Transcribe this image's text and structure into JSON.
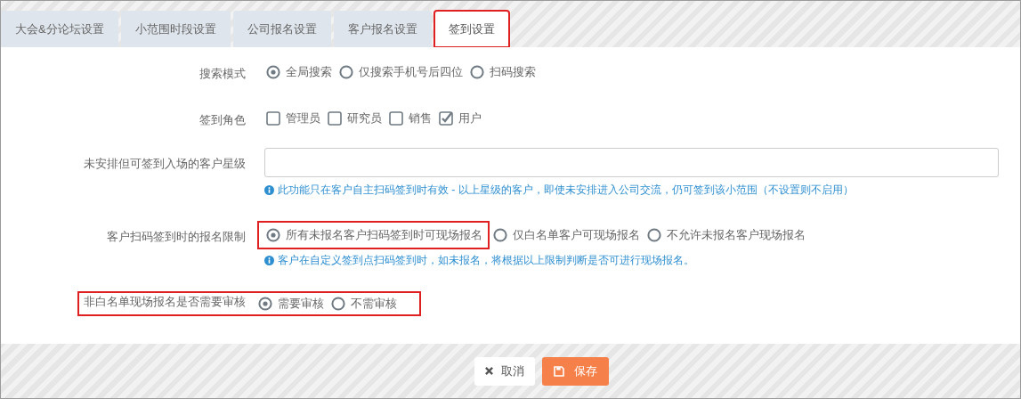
{
  "tabs": [
    {
      "label": "大会&分论坛设置",
      "selected": false,
      "highlighted": false
    },
    {
      "label": "小范围时段设置",
      "selected": false,
      "highlighted": false
    },
    {
      "label": "公司报名设置",
      "selected": false,
      "highlighted": false
    },
    {
      "label": "客户报名设置",
      "selected": false,
      "highlighted": false
    },
    {
      "label": "签到设置",
      "selected": true,
      "highlighted": true
    }
  ],
  "form": [
    {
      "kind": "radio",
      "label": "搜索模式",
      "highlighted": false,
      "options": [
        {
          "label": "全局搜索",
          "selected": true,
          "highlighted": false
        },
        {
          "label": "仅搜索手机号后四位",
          "selected": false,
          "highlighted": false
        },
        {
          "label": "扫码搜索",
          "selected": false,
          "highlighted": false
        }
      ]
    },
    {
      "kind": "checkbox",
      "label": "签到角色",
      "highlighted": false,
      "options": [
        {
          "label": "管理员",
          "checked": false
        },
        {
          "label": "研究员",
          "checked": false
        },
        {
          "label": "销售",
          "checked": false
        },
        {
          "label": "用户",
          "checked": true
        }
      ]
    },
    {
      "kind": "input",
      "label": "未安排但可签到入场的客户星级",
      "highlighted": false,
      "help": "此功能只在客户自主扫码签到时有效 - 以上星级的客户，即使未安排进入公司交流，仍可签到该小范围（不设置则不启用）"
    },
    {
      "kind": "radio",
      "label": "客户扫码签到时的报名限制",
      "highlighted": false,
      "help": "客户在自定义签到点扫码签到时，如未报名，将根据以上限制判断是否可进行现场报名。",
      "options": [
        {
          "label": "所有未报名客户扫码签到时可现场报名",
          "selected": true,
          "highlighted": true
        },
        {
          "label": "仅白名单客户可现场报名",
          "selected": false,
          "highlighted": false
        },
        {
          "label": "不允许未报名客户现场报名",
          "selected": false,
          "highlighted": false
        }
      ]
    },
    {
      "kind": "radio",
      "label": "非白名单现场报名是否需要审核",
      "highlighted": true,
      "options": [
        {
          "label": "需要审核",
          "selected": true,
          "highlighted": false
        },
        {
          "label": "不需审核",
          "selected": false,
          "highlighted": false
        }
      ]
    }
  ],
  "buttons": [
    {
      "kind": "cancel",
      "label": "取消"
    },
    {
      "kind": "save",
      "label": "保存"
    }
  ]
}
